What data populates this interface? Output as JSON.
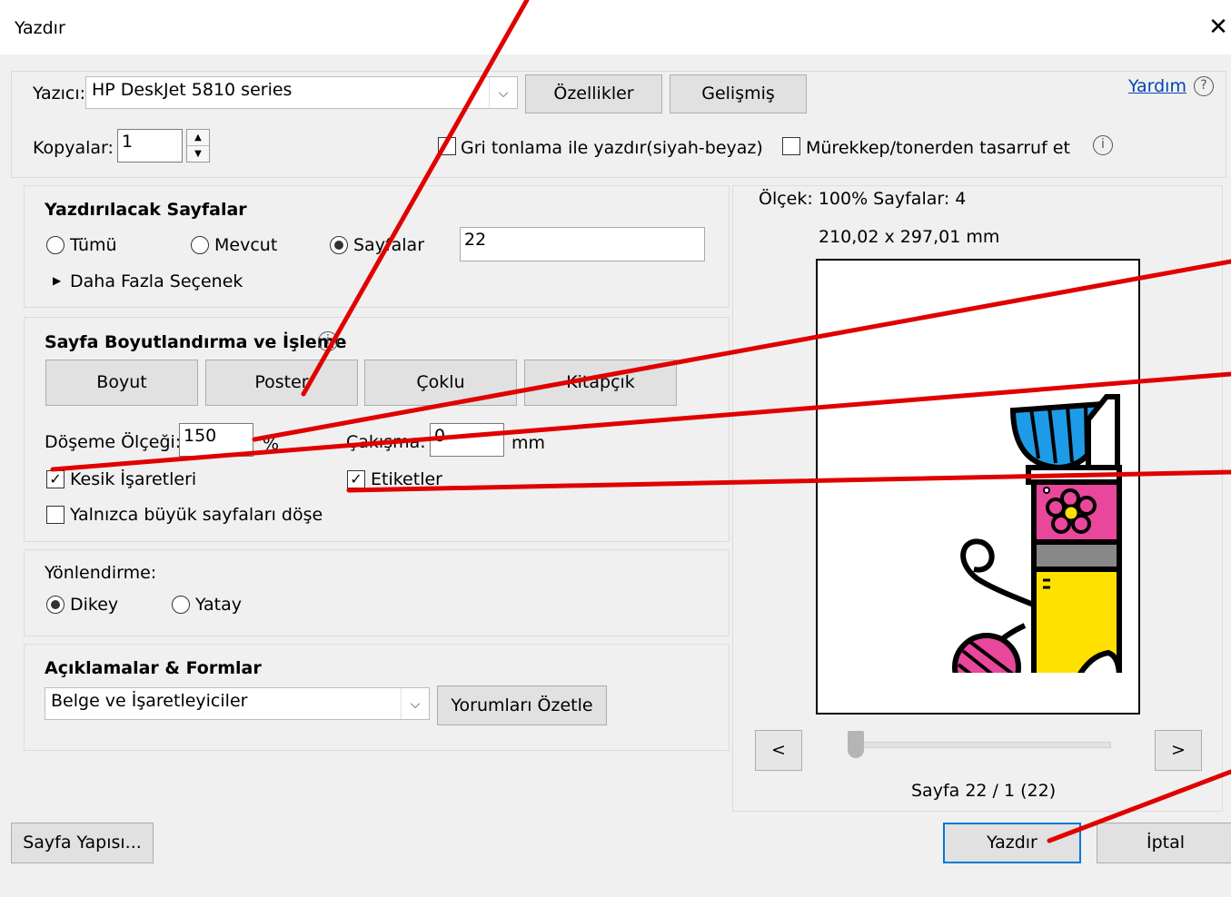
{
  "window": {
    "title": "Yazdır"
  },
  "printer": {
    "label": "Yazıcı:",
    "value": "HP DeskJet 5810 series",
    "properties_button": "Özellikler",
    "advanced_button": "Gelişmiş",
    "help_link": "Yardım"
  },
  "copies": {
    "label": "Kopyalar:",
    "value": "1",
    "grayscale_label": "Gri tonlama ile yazdır(siyah-beyaz)",
    "grayscale_checked": false,
    "ink_save_label": "Mürekkep/tonerden tasarruf et",
    "ink_save_checked": false
  },
  "pages_section": {
    "title": "Yazdırılacak Sayfalar",
    "options": [
      {
        "label": "Tümü",
        "selected": false
      },
      {
        "label": "Mevcut",
        "selected": false
      },
      {
        "label": "Sayfalar",
        "selected": true
      }
    ],
    "pages_value": "22",
    "more_options": "Daha Fazla Seçenek"
  },
  "sizing_section": {
    "title": "Sayfa Boyutlandırma ve İşleme",
    "tabs": [
      "Boyut",
      "Poster",
      "Çoklu",
      "Kitapçık"
    ],
    "tile_scale_label": "Döşeme Ölçeği:",
    "tile_scale_value": "150",
    "tile_scale_unit": "%",
    "overlap_label": "Çakışma:",
    "overlap_value": "0",
    "overlap_unit": "mm",
    "cut_marks_label": "Kesik İşaretleri",
    "cut_marks_checked": true,
    "labels_label": "Etiketler",
    "labels_checked": true,
    "large_pages_label": "Yalnızca büyük sayfaları döşe",
    "large_pages_checked": false
  },
  "orientation_section": {
    "title": "Yönlendirme:",
    "options": [
      {
        "label": "Dikey",
        "selected": true
      },
      {
        "label": "Yatay",
        "selected": false
      }
    ]
  },
  "comments_section": {
    "title": "Açıklamalar & Formlar",
    "value": "Belge ve İşaretleyiciler",
    "summarize_button": "Yorumları Özetle"
  },
  "preview": {
    "scale_text": "Ölçek: 100% Sayfalar: 4",
    "size_text": "210,02 x 297,01 mm",
    "prev_button": "<",
    "next_button": ">",
    "page_text": "Sayfa 22 / 1 (22)",
    "slider_fraction": 0
  },
  "footer": {
    "page_setup_button": "Sayfa Yapısı...",
    "print_button": "Yazdır",
    "cancel_button": "İptal"
  },
  "colors": {
    "annotation": "#e00000",
    "link": "#0645ad",
    "illustration_blue": "#1e9be6",
    "illustration_pink": "#e8479b",
    "illustration_yellow": "#ffe100"
  }
}
